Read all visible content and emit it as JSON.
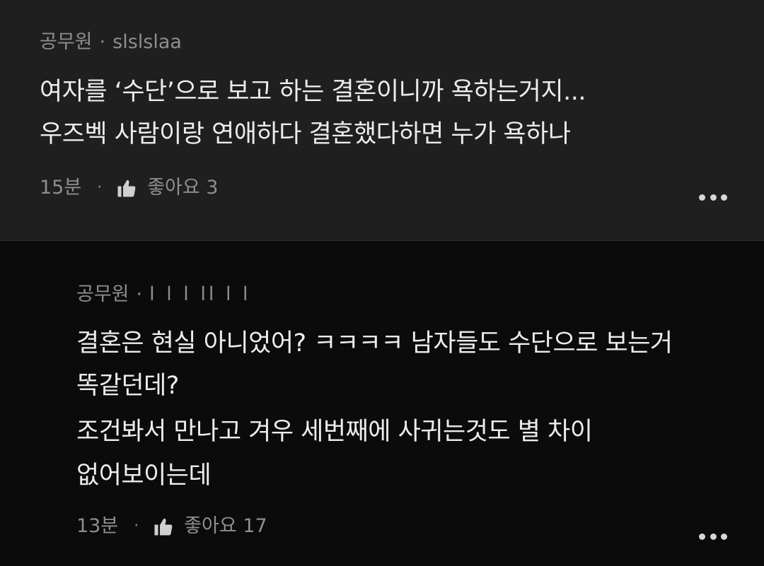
{
  "comments": [
    {
      "job": "공무원",
      "separator": "·",
      "username": "slslslaa",
      "lines": [
        "여자를 ‘수단’으로 보고 하는 결혼이니까 욕하는거지...",
        "우즈벡 사람이랑 연애하다 결혼했다하면 누가 욕하나"
      ],
      "time": "15분",
      "dot": "·",
      "like_label": "좋아요 3"
    },
    {
      "job": "공무원",
      "separator": "·",
      "username": "l l l ll l  l",
      "lines": [
        "결혼은 현실 아니었어? ㅋㅋㅋㅋ 남자들도 수단으로 보는거",
        "똑같던데?",
        "조건봐서 만나고 겨우 세번째에 사귀는것도 별 차이",
        "없어보이는데"
      ],
      "time": "13분",
      "dot": "·",
      "like_label": "좋아요 17"
    }
  ],
  "icons": {
    "like": "thumbs-up-icon",
    "more": "more-horizontal-icon"
  },
  "colors": {
    "card_1_bg": "#1f1f1f",
    "card_2_bg": "#0b0b0b",
    "meta_text": "#8e8e8e",
    "body_text": "#ececec"
  }
}
